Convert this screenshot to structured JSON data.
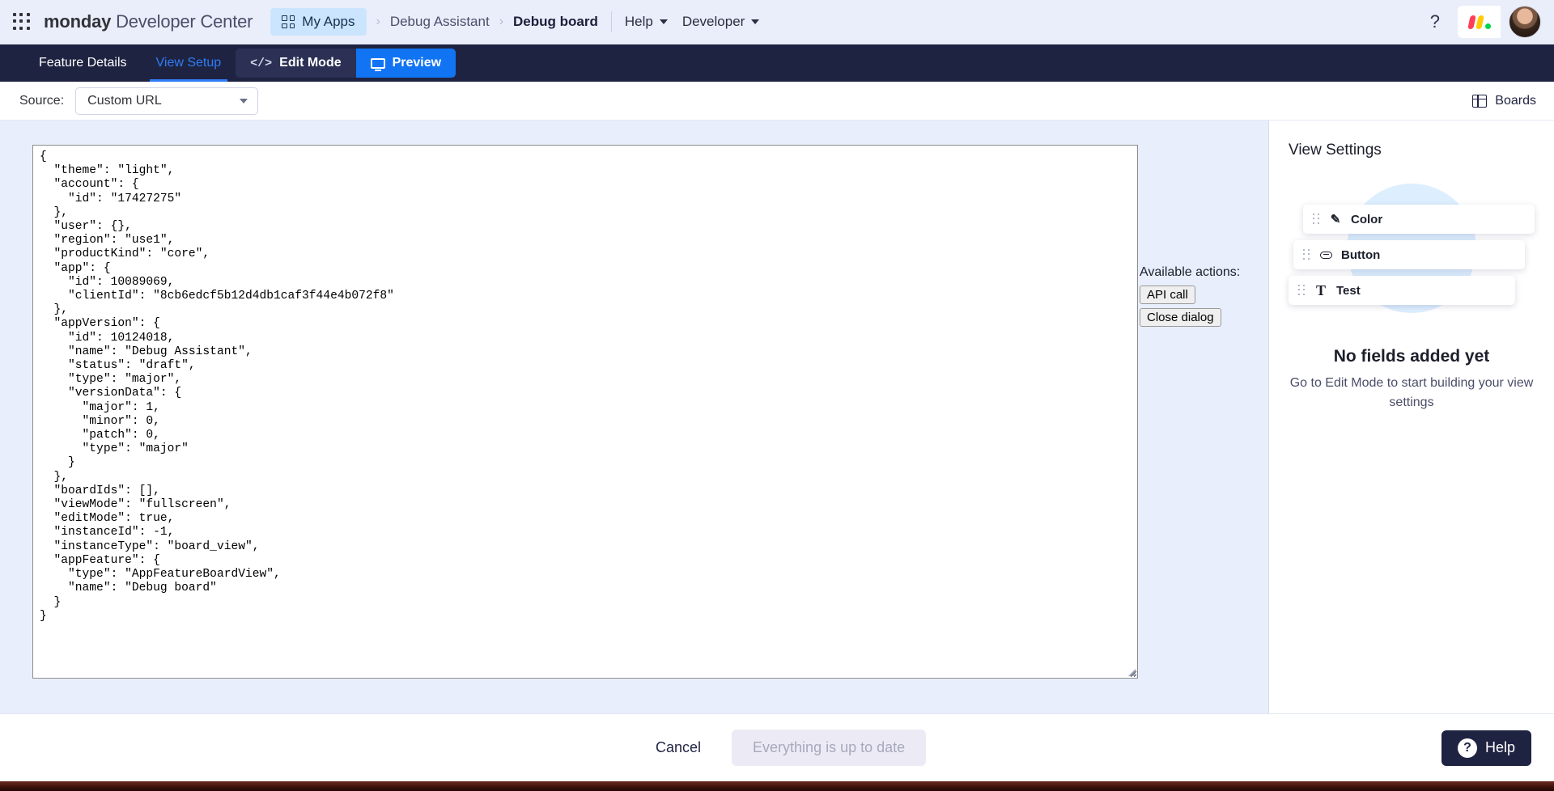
{
  "header": {
    "grid_icon": "apps-grid-icon",
    "brand_bold": "monday",
    "brand_light": " Developer Center",
    "my_apps": "My Apps",
    "my_apps_icon": "apps-squares-icon",
    "breadcrumb_sep": "›",
    "crumb_app": "Debug Assistant",
    "crumb_board": "Debug board",
    "help_menu": "Help",
    "developer_menu": "Developer",
    "question_icon": "question-mark-icon",
    "monday_logo": "monday-logo-icon",
    "avatar": "user-avatar"
  },
  "tabs": {
    "items": [
      {
        "label": "Feature Details",
        "active": false
      },
      {
        "label": "View Setup",
        "active": true
      }
    ],
    "edit_mode": "Edit Mode",
    "edit_mode_icon": "code-brackets-icon",
    "preview": "Preview",
    "preview_icon": "monitor-icon"
  },
  "source_row": {
    "label": "Source:",
    "select_value": "Custom URL",
    "chevron_icon": "chevron-down-icon",
    "boards_label": "Boards",
    "boards_icon": "table-grid-icon"
  },
  "editor": {
    "content": "{\n  \"theme\": \"light\",\n  \"account\": {\n    \"id\": \"17427275\"\n  },\n  \"user\": {},\n  \"region\": \"use1\",\n  \"productKind\": \"core\",\n  \"app\": {\n    \"id\": 10089069,\n    \"clientId\": \"8cb6edcf5b12d4db1caf3f44e4b072f8\"\n  },\n  \"appVersion\": {\n    \"id\": 10124018,\n    \"name\": \"Debug Assistant\",\n    \"status\": \"draft\",\n    \"type\": \"major\",\n    \"versionData\": {\n      \"major\": 1,\n      \"minor\": 0,\n      \"patch\": 0,\n      \"type\": \"major\"\n    }\n  },\n  \"boardIds\": [],\n  \"viewMode\": \"fullscreen\",\n  \"editMode\": true,\n  \"instanceId\": -1,\n  \"instanceType\": \"board_view\",\n  \"appFeature\": {\n    \"type\": \"AppFeatureBoardView\",\n    \"name\": \"Debug board\"\n  }\n}"
  },
  "actions": {
    "title": "Available actions:",
    "api_call": "API call",
    "close_dialog": "Close dialog"
  },
  "settings": {
    "title": "View Settings",
    "cards": [
      {
        "label": "Color",
        "icon": "pen-icon"
      },
      {
        "label": "Button",
        "icon": "button-pill-icon"
      },
      {
        "label": "Test",
        "icon": "text-t-icon"
      }
    ],
    "drag_icon": "drag-handle-icon",
    "empty_title": "No fields added yet",
    "empty_sub": "Go to Edit Mode to start building your view settings"
  },
  "footer": {
    "cancel": "Cancel",
    "status": "Everything is up to date",
    "help": "Help",
    "help_icon": "question-circle-icon"
  },
  "colors": {
    "accent_blue": "#1174f3",
    "dark_navy": "#1f2342",
    "header_bg": "#eaeefa",
    "canvas_bg": "#e8eefb"
  }
}
